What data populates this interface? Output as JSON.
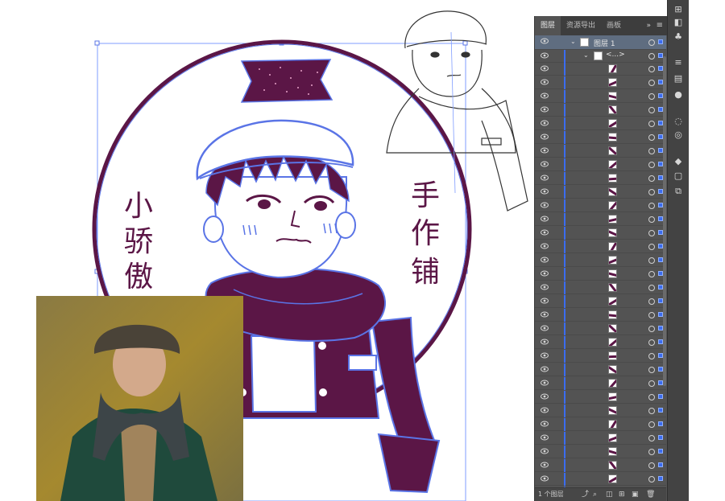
{
  "artwork": {
    "left_text": "小骄傲",
    "right_text": "手作铺"
  },
  "layers_panel": {
    "tabs": [
      "图层",
      "资源导出",
      "画板"
    ],
    "more_label": "»",
    "menu_label": "≡",
    "layer_name": "图层 1",
    "group_name": "<...>",
    "footer_text": "1 个图层",
    "row_count": 32,
    "colors": {
      "panel_bg": "#535353",
      "selection_blue": "#3b6cf0",
      "art_purple": "#5b1646",
      "outline_blue": "#5a74e6"
    }
  },
  "icons": [
    "eye-icon",
    "expand-arrow-icon",
    "target-circle-icon",
    "selection-square-icon",
    "new-layer-icon",
    "delete-icon",
    "search-icon",
    "export-icon"
  ]
}
